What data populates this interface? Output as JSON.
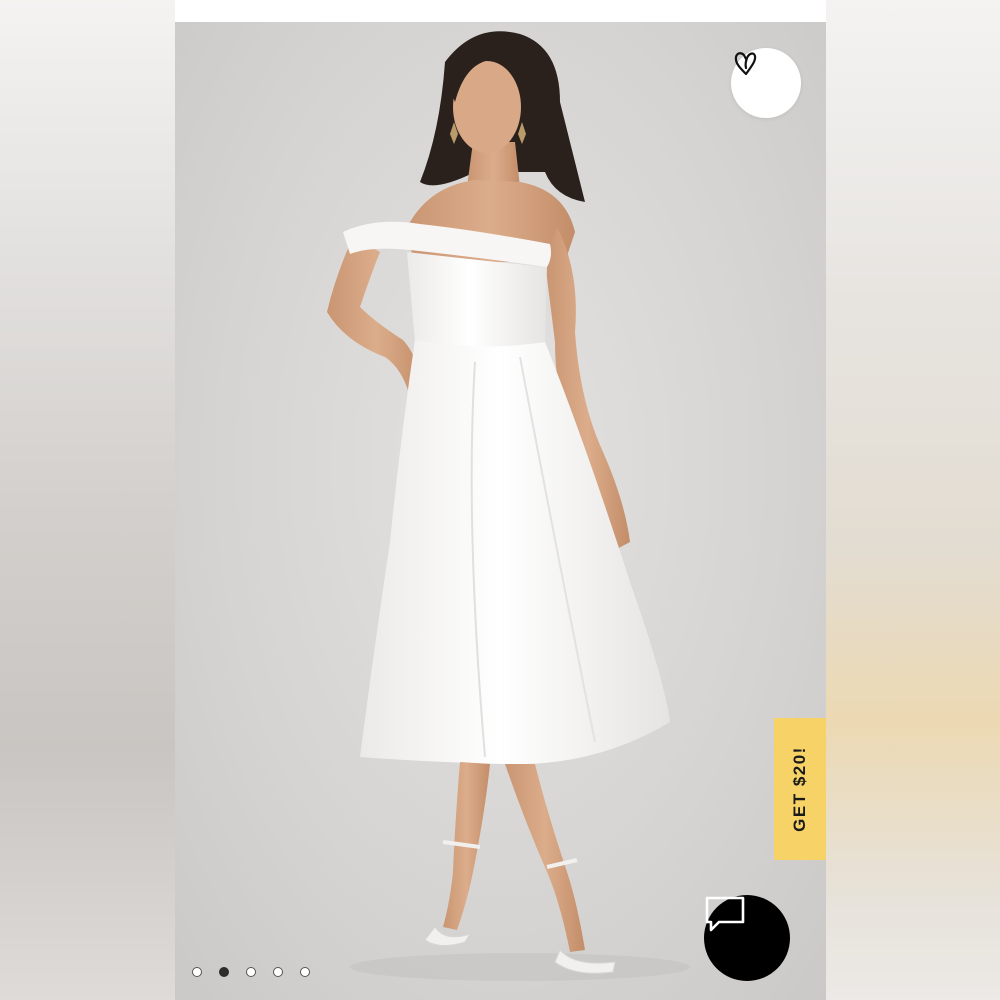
{
  "product_gallery": {
    "favorite_icon": "heart-outline-icon",
    "promo_label": "GET $20!",
    "chat_icon": "chat-bubble-icon",
    "slide_count": 5,
    "active_slide": 2
  },
  "colors": {
    "promo": "#f6d267",
    "chat_button": "#000000",
    "dress": "#ffffff"
  }
}
